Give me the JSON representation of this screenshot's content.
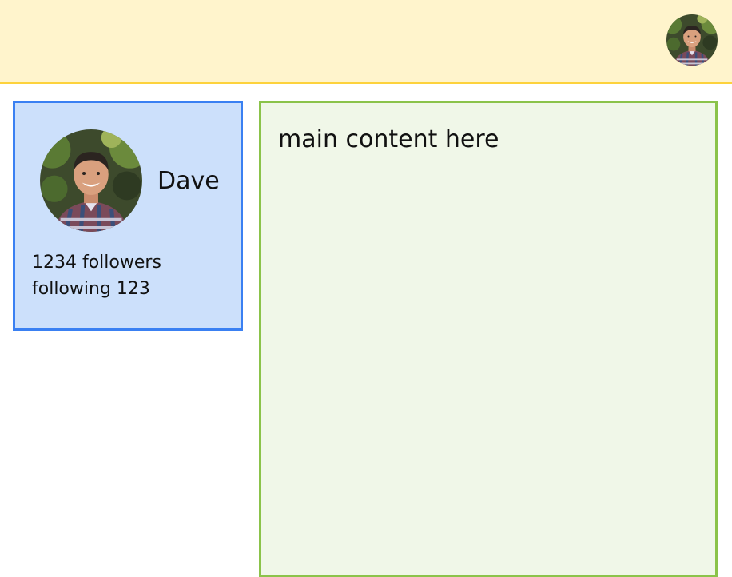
{
  "header": {
    "avatar_icon": "user-avatar-photo",
    "colors": {
      "background": "#fff4cc",
      "border": "#fdd23c"
    }
  },
  "profile": {
    "avatar_icon": "user-avatar-photo",
    "name": "Dave",
    "followers": "1234 followers",
    "following": "following 123",
    "colors": {
      "background": "#cce0fb",
      "border": "#3a80f2"
    }
  },
  "main": {
    "text": "main content here",
    "colors": {
      "background": "#f0f7e8",
      "border": "#8bc34a"
    }
  }
}
